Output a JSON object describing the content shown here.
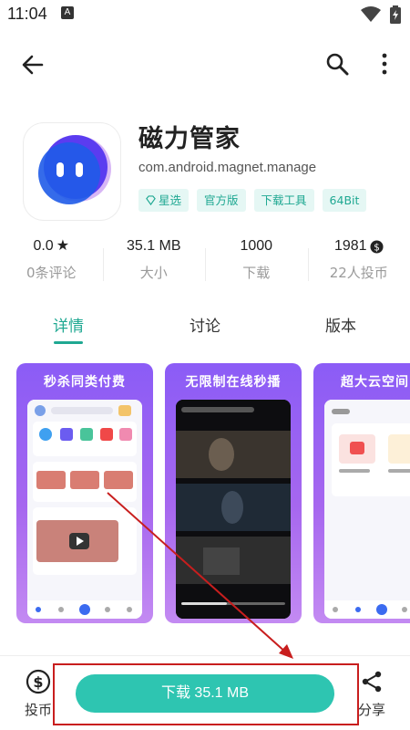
{
  "status_bar": {
    "time": "11:04",
    "notif_letter": "A"
  },
  "app": {
    "name": "磁力管家",
    "package": "com.android.magnet.manage",
    "tags": [
      "星选",
      "官方版",
      "下载工具",
      "64Bit"
    ]
  },
  "stats": [
    {
      "value": "0.0",
      "label": "0条评论"
    },
    {
      "value": "35.1 MB",
      "label": "大小"
    },
    {
      "value": "1000",
      "label": "下载"
    },
    {
      "value": "1981",
      "label": "22人投币"
    }
  ],
  "tabs": [
    "详情",
    "讨论",
    "版本"
  ],
  "screenshots": [
    {
      "title": "秒杀同类付费"
    },
    {
      "title": "无限制在线秒播"
    },
    {
      "title": "超大云空间内"
    }
  ],
  "bottom": {
    "coin_label": "投币",
    "download_label": "下载 35.1 MB",
    "share_label": "分享"
  },
  "colors": {
    "accent": "#2ec5b1",
    "tab_active": "#1fa892",
    "annotation": "#c81e1e"
  }
}
